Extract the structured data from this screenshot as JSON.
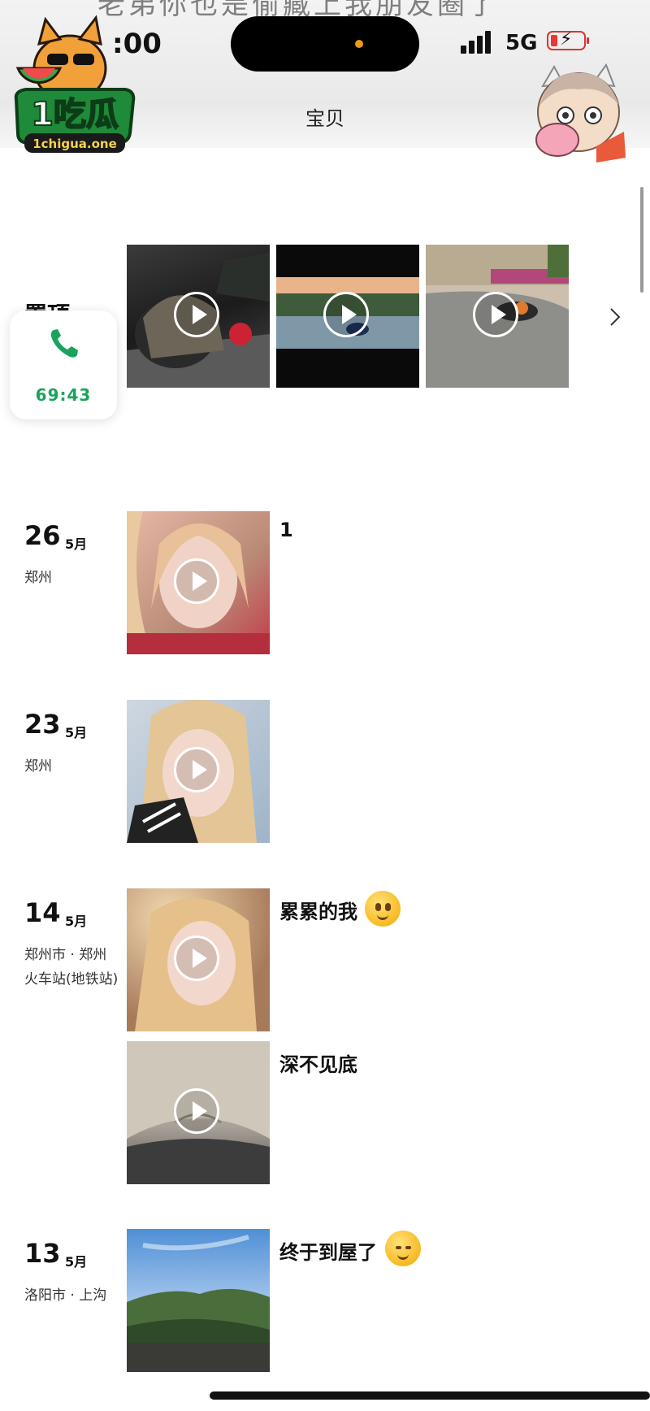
{
  "status_bar": {
    "time": ":00",
    "network": "5G"
  },
  "overlay_title": "老弟你也是偷藏上我朋友圈了",
  "nav": {
    "title": "宝贝"
  },
  "logo": {
    "text": "1吃瓜",
    "url_text": "1chigua.one"
  },
  "pinned": {
    "label": "置顶",
    "videos": 3
  },
  "call": {
    "timer": "69:43"
  },
  "posts": [
    {
      "day": "26",
      "month": "5月",
      "location": "郑州",
      "caption": "1"
    },
    {
      "day": "23",
      "month": "5月",
      "location": "郑州",
      "caption": ""
    },
    {
      "day": "14",
      "month": "5月",
      "location": "郑州市 · 郑州火车站(地铁站)",
      "captions": [
        "累累的我",
        "深不见底"
      ]
    },
    {
      "day": "13",
      "month": "5月",
      "location": "洛阳市 · 上沟",
      "caption": "终于到屋了"
    }
  ],
  "icons": [
    "play-icon",
    "phone-icon",
    "chevron-right-icon",
    "emoji-face-icon"
  ],
  "colors": {
    "call_green": "#1aa35b",
    "battery_red": "#e53935"
  }
}
